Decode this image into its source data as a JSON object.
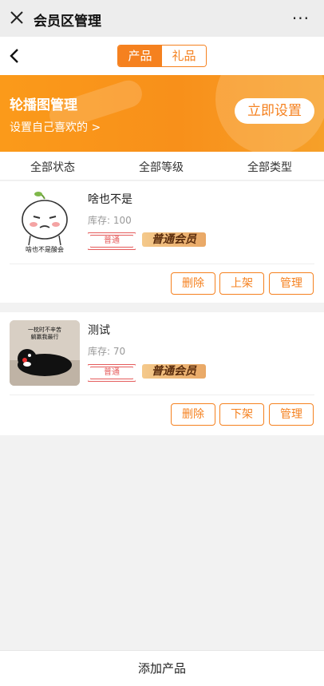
{
  "window": {
    "title": "会员区管理",
    "more": "···"
  },
  "tabs": [
    {
      "label": "产品"
    },
    {
      "label": "礼品"
    }
  ],
  "banner": {
    "title": "轮播图管理",
    "subtitle": "设置自己喜欢的 >",
    "button": "立即设置"
  },
  "filters": {
    "status": "全部状态",
    "level": "全部等级",
    "type": "全部类型"
  },
  "products": [
    {
      "name": "啥也不是",
      "stock": "库存:  100",
      "level": "普通",
      "member_tag": "普通会员",
      "thumb_caption": "啥也不是酸会",
      "actions": [
        "删除",
        "上架",
        "管理"
      ]
    },
    {
      "name": "测试",
      "stock": "库存:  70",
      "level": "普通",
      "member_tag": "普通会员",
      "thumb_caption": "一枕时不辛苦\n躺赢我最行",
      "actions": [
        "删除",
        "下架",
        "管理"
      ]
    }
  ],
  "footer": {
    "add_label": "添加产品"
  },
  "colors": {
    "accent": "#f5811f",
    "level_border": "#e55b5b"
  }
}
